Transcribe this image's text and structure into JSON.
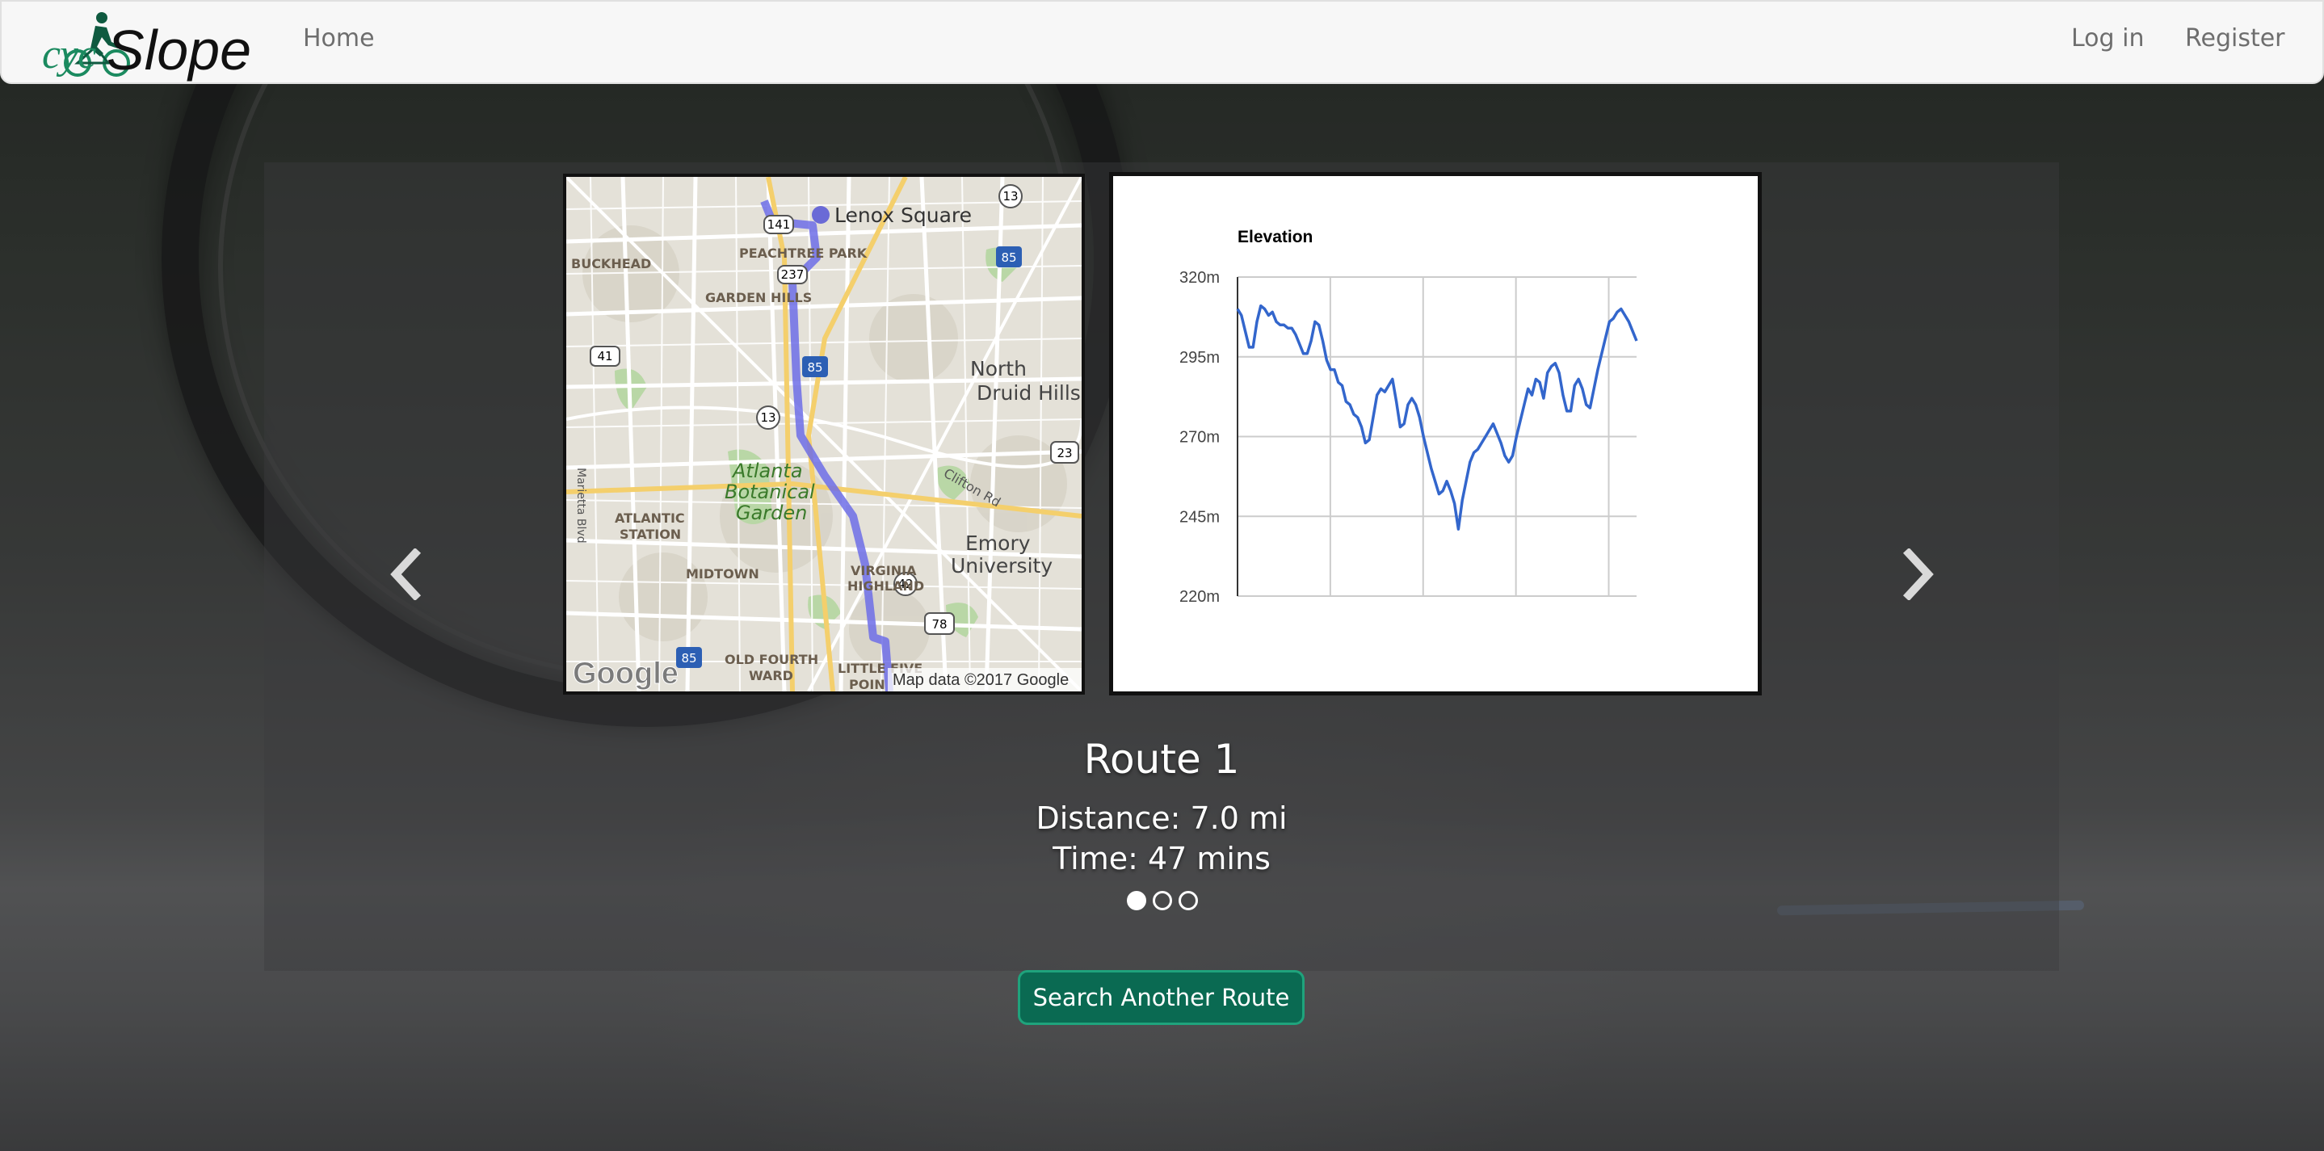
{
  "navbar": {
    "brand_prefix": "cyc",
    "brand_suffix": "Slope",
    "home_label": "Home",
    "login_label": "Log in",
    "register_label": "Register"
  },
  "map": {
    "labels": {
      "lenox": "Lenox Square",
      "peachtree": "PEACHTREE PARK",
      "buckhead": "BUCKHEAD",
      "garden_hills": "GARDEN HILLS",
      "north_druid_1": "North",
      "north_druid_2": "Druid Hills",
      "atlanta_botanical_1": "Atlanta",
      "atlanta_botanical_2": "Botanical",
      "atlanta_botanical_3": "Garden",
      "atlantic_station_1": "ATLANTIC",
      "atlantic_station_2": "STATION",
      "emory_1": "Emory",
      "emory_2": "University",
      "midtown": "MIDTOWN",
      "virginia_highland_1": "VIRGINIA",
      "virginia_highland_2": "HIGHLAND",
      "old_fourth_1": "OLD FOURTH",
      "old_fourth_2": "WARD",
      "little_five": "LITTLE FIVE",
      "point": "POIN",
      "clifton": "Clifton Rd",
      "marietta": "Marietta Blvd",
      "google": "Google",
      "copyright": "Map data ©2017 Google"
    },
    "shields": [
      "141",
      "237",
      "13",
      "85",
      "41",
      "13",
      "23",
      "42",
      "78",
      "85"
    ]
  },
  "chart_data": {
    "type": "line",
    "title": "Elevation",
    "xlabel": "",
    "ylabel": "",
    "y_ticks": [
      "320m",
      "295m",
      "270m",
      "245m",
      "220m"
    ],
    "ylim": [
      220,
      320
    ],
    "grid": true,
    "series": [
      {
        "values": [
          310,
          308,
          303,
          298,
          298,
          306,
          311,
          310,
          308,
          309,
          306,
          305,
          305,
          304,
          304,
          302,
          299,
          296,
          296,
          300,
          306,
          305,
          300,
          294,
          291,
          291,
          287,
          286,
          281,
          280,
          277,
          276,
          273,
          268,
          269,
          276,
          283,
          285,
          284,
          286,
          288,
          281,
          273,
          274,
          280,
          282,
          280,
          276,
          270,
          265,
          260,
          256,
          252,
          253,
          256,
          253,
          249,
          241,
          250,
          256,
          262,
          265,
          266,
          268,
          270,
          272,
          274,
          271,
          268,
          264,
          262,
          264,
          270,
          275,
          280,
          285,
          283,
          288,
          287,
          282,
          290,
          292,
          293,
          290,
          283,
          278,
          278,
          286,
          288,
          285,
          280,
          279,
          285,
          291,
          296,
          301,
          306,
          307,
          309,
          310,
          308,
          306,
          303,
          300
        ]
      }
    ],
    "color": "#3366cc"
  },
  "route": {
    "title": "Route 1",
    "distance": "Distance: 7.0 mi",
    "time": "Time: 47 mins"
  },
  "carousel": {
    "active_index": 0,
    "count": 3
  },
  "search_button_label": "Search Another Route"
}
